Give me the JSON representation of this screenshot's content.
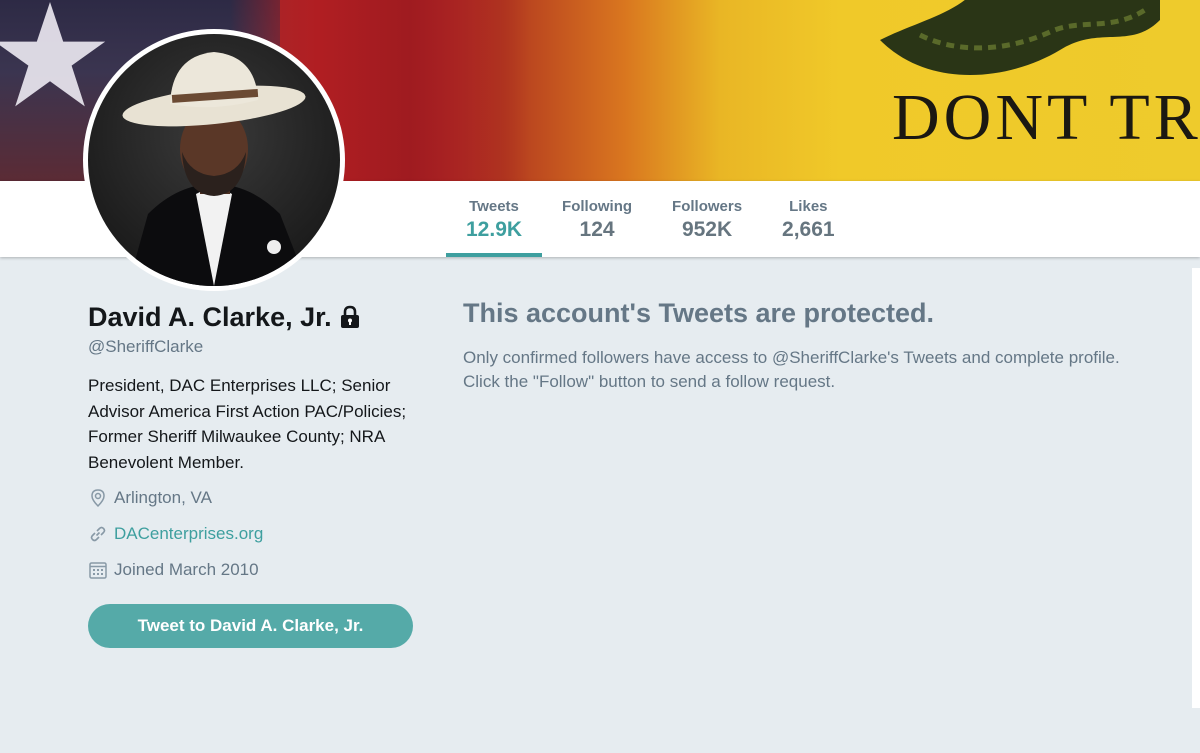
{
  "header": {
    "banner_text": "DONT TR",
    "colors": {
      "accent": "#3e9f9f",
      "button": "#55aaa8",
      "background": "#e6ecf0"
    }
  },
  "nav": {
    "stats": [
      {
        "label": "Tweets",
        "value": "12.9K",
        "active": true
      },
      {
        "label": "Following",
        "value": "124",
        "active": false
      },
      {
        "label": "Followers",
        "value": "952K",
        "active": false
      },
      {
        "label": "Likes",
        "value": "2,661",
        "active": false
      }
    ]
  },
  "profile": {
    "name": "David A. Clarke, Jr.",
    "handle": "@SheriffClarke",
    "bio": "President, DAC Enterprises LLC; Senior Advisor America First Action PAC/Policies; Former Sheriff Milwaukee County; NRA Benevolent Member.",
    "location": "Arlington, VA",
    "website": "DACenterprises.org",
    "joined": "Joined March 2010",
    "tweet_button": "Tweet to David A. Clarke, Jr.",
    "icons": {
      "lock": "lock-icon",
      "location": "location-pin-icon",
      "link": "link-icon",
      "calendar": "calendar-icon"
    }
  },
  "protected": {
    "title": "This account's Tweets are protected.",
    "line1": "Only confirmed followers have access to @SheriffClarke's Tweets and complete profile.",
    "line2": "Click the \"Follow\" button to send a follow request."
  }
}
